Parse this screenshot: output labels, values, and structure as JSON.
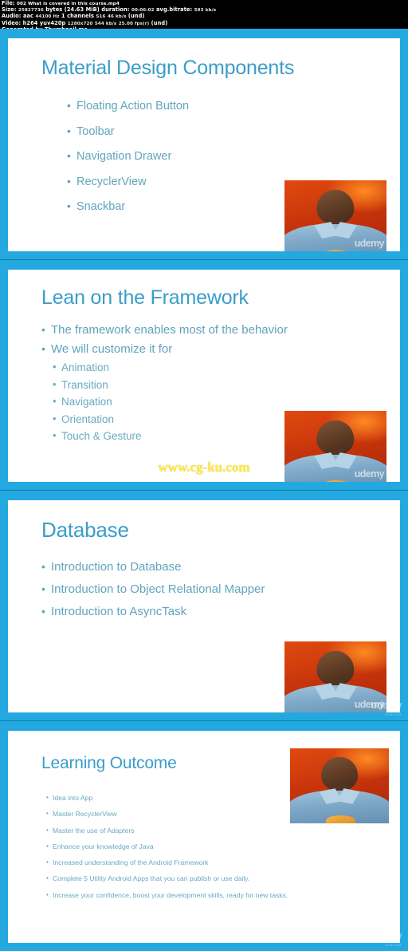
{
  "media_info": {
    "file_label": "File:",
    "file_value": "002 What is covered in this course.mp4",
    "size_label": "Size:",
    "size_bytes": "25827736",
    "size_bytes_unit": "bytes",
    "size_mib": "(24.63 MiB)",
    "duration_label": "duration:",
    "duration_value": "00:06:02",
    "bitrate_label": "avg.bitrate:",
    "bitrate_value": "593 kb/s",
    "audio_label": "Audio:",
    "audio_codec": "aac",
    "audio_rate": "44100 Hz",
    "audio_channels": "1 channels",
    "audio_extra": "S16",
    "audio_bitrate": "46 kb/s",
    "audio_lang": "(und)",
    "video_label": "Video:",
    "video_codec": "h264",
    "video_pixfmt": "yuv420p",
    "video_res": "1280x720",
    "video_bitrate": "544 kb/s",
    "video_fps": "25.00 fps(r)",
    "video_lang": "(und)",
    "generated_by": "Generated by Thumbnail me"
  },
  "colors": {
    "frame_blue": "#23a9e0",
    "title_blue": "#3b9dc9",
    "bullet_blue": "#62a5be",
    "watermark_yellow": "#ffec3d",
    "thumb_bg_orange": "#c8350b"
  },
  "branding": {
    "player_logo": "udemy",
    "player_logo_sub": "Android",
    "site_watermark": "www.cg-ku.com"
  },
  "slides": [
    {
      "title": "Material Design Components",
      "bullets": [
        "Floating Action Button",
        "Toolbar",
        "Navigation Drawer",
        "RecyclerView",
        "Snackbar"
      ],
      "sub_bullets": [],
      "watermark": ""
    },
    {
      "title": "Lean on the Framework",
      "bullets": [
        "The framework enables most of the behavior",
        "We will customize it for"
      ],
      "sub_bullets": [
        "Animation",
        "Transition",
        "Navigation",
        "Orientation",
        "Touch & Gesture"
      ],
      "watermark": "www.cg-ku.com"
    },
    {
      "title": "Database",
      "bullets": [
        "Introduction to Database",
        "Introduction to Object Relational Mapper",
        "Introduction to AsyncTask"
      ],
      "sub_bullets": [],
      "watermark": ""
    },
    {
      "title": "Learning Outcome",
      "bullets": [
        "Idea into App",
        "Master RecyclerView",
        "Master the use of Adapters",
        "Enhance your knowledge of Java",
        "Increased understanding of the Android Framework",
        "Complete 5 Utility Android Apps that you can publish or use daily.",
        "Increase your confidence, boost your development skills, ready for new tasks."
      ],
      "sub_bullets": [],
      "watermark": ""
    }
  ]
}
